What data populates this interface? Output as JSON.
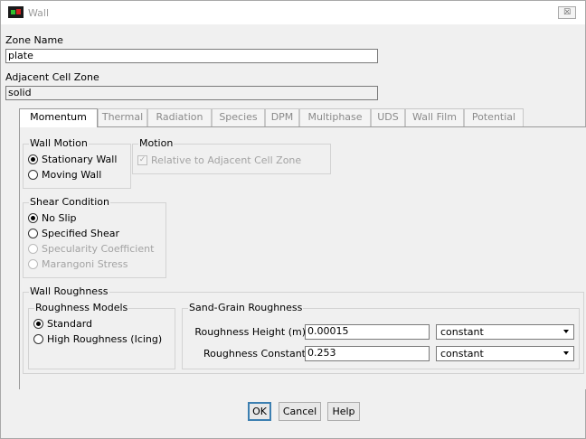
{
  "window": {
    "title": "Wall",
    "close_glyph": "☒"
  },
  "zone_name": {
    "label": "Zone Name",
    "value": "plate"
  },
  "adjacent_cell_zone": {
    "label": "Adjacent Cell Zone",
    "value": "solid"
  },
  "tabs": [
    {
      "label": "Momentum",
      "active": true
    },
    {
      "label": "Thermal"
    },
    {
      "label": "Radiation"
    },
    {
      "label": "Species"
    },
    {
      "label": "DPM"
    },
    {
      "label": "Multiphase"
    },
    {
      "label": "UDS"
    },
    {
      "label": "Wall Film"
    },
    {
      "label": "Potential"
    }
  ],
  "wall_motion": {
    "title": "Wall Motion",
    "options": [
      {
        "label": "Stationary Wall",
        "checked": true
      },
      {
        "label": "Moving Wall",
        "checked": false
      }
    ]
  },
  "motion": {
    "title": "Motion",
    "checkbox_label": "Relative to Adjacent Cell Zone",
    "check_glyph": "✓"
  },
  "shear_condition": {
    "title": "Shear Condition",
    "options": [
      {
        "label": "No Slip",
        "checked": true,
        "disabled": false
      },
      {
        "label": "Specified Shear",
        "checked": false,
        "disabled": false
      },
      {
        "label": "Specularity Coefficient",
        "checked": false,
        "disabled": true
      },
      {
        "label": "Marangoni Stress",
        "checked": false,
        "disabled": true
      }
    ]
  },
  "wall_roughness": {
    "title": "Wall Roughness",
    "models": {
      "title": "Roughness Models",
      "options": [
        {
          "label": "Standard",
          "checked": true
        },
        {
          "label": "High Roughness (Icing)",
          "checked": false
        }
      ]
    },
    "sand_grain": {
      "title": "Sand-Grain Roughness",
      "height": {
        "label": "Roughness Height (m)",
        "value": "0.00015",
        "method": "constant"
      },
      "constant": {
        "label": "Roughness Constant",
        "value": "0.253",
        "method": "constant"
      }
    }
  },
  "buttons": {
    "ok": "OK",
    "cancel": "Cancel",
    "help": "Help"
  }
}
